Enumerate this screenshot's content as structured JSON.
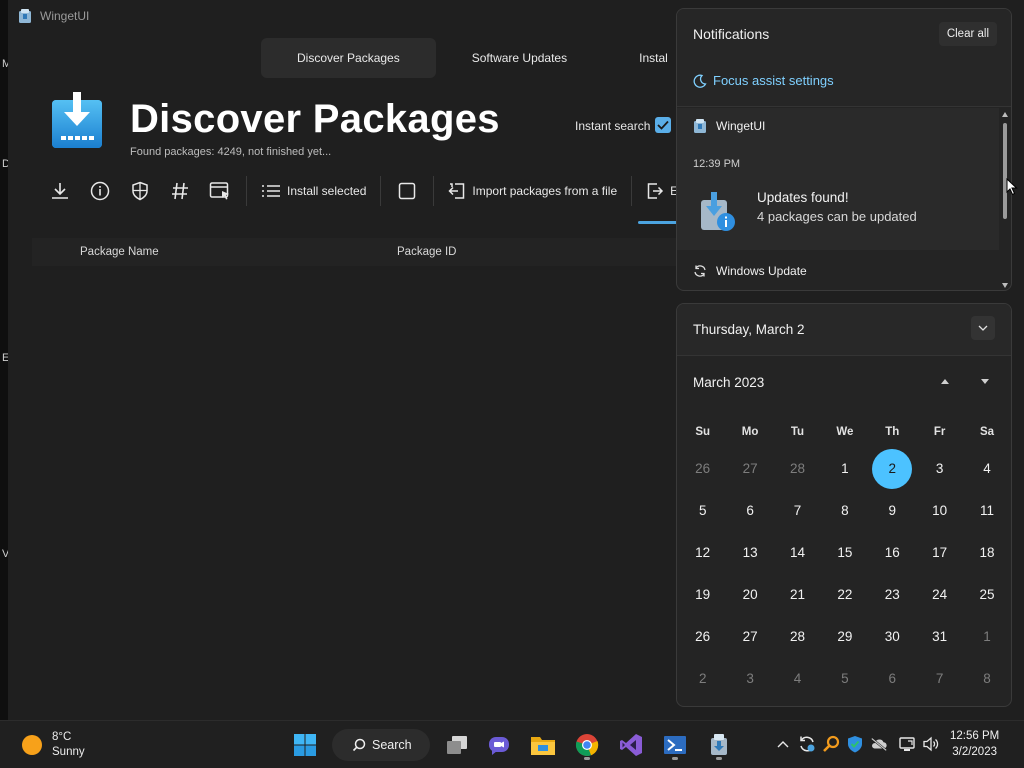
{
  "window": {
    "title": "WingetUI"
  },
  "desktop_edge_letters": [
    "M",
    "D",
    "E",
    "V"
  ],
  "tabs": [
    {
      "label": "Discover Packages",
      "active": true
    },
    {
      "label": "Software Updates",
      "active": false
    },
    {
      "label": "Instal",
      "active": false
    }
  ],
  "page": {
    "title": "Discover Packages",
    "subtitle": "Found packages: 4249, not finished yet...",
    "instant_search_label": "Instant search",
    "instant_search_checked": true
  },
  "toolbar": {
    "install_selected": "Install selected",
    "import_label": "Import packages from a file",
    "export_label": "Expo"
  },
  "table": {
    "columns": [
      "Package Name",
      "Package ID"
    ]
  },
  "notifications": {
    "title": "Notifications",
    "clear_all": "Clear all",
    "focus_assist": "Focus assist settings",
    "app_name": "WingetUI",
    "time": "12:39 PM",
    "heading": "Updates found!",
    "body": "4 packages can be updated",
    "other_app": "Windows Update"
  },
  "calendar": {
    "date_label": "Thursday, March 2",
    "month_label": "March 2023",
    "weekdays": [
      "Su",
      "Mo",
      "Tu",
      "We",
      "Th",
      "Fr",
      "Sa"
    ],
    "weeks": [
      [
        "26",
        "27",
        "28",
        "1",
        "2",
        "3",
        "4"
      ],
      [
        "5",
        "6",
        "7",
        "8",
        "9",
        "10",
        "11"
      ],
      [
        "12",
        "13",
        "14",
        "15",
        "16",
        "17",
        "18"
      ],
      [
        "19",
        "20",
        "21",
        "22",
        "23",
        "24",
        "25"
      ],
      [
        "26",
        "27",
        "28",
        "29",
        "30",
        "31",
        "1"
      ],
      [
        "2",
        "3",
        "4",
        "5",
        "6",
        "7",
        "8"
      ]
    ],
    "today": "2",
    "accent_color": "#4cc2ff"
  },
  "taskbar": {
    "weather_temp": "8°C",
    "weather_desc": "Sunny",
    "search_label": "Search",
    "clock_time": "12:56 PM",
    "clock_date": "3/2/2023",
    "apps": [
      "start-icon",
      "task-view-icon",
      "teams-chat-icon",
      "file-explorer-icon",
      "chrome-icon",
      "visual-studio-icon",
      "powershell-icon",
      "wingetui-icon"
    ]
  }
}
